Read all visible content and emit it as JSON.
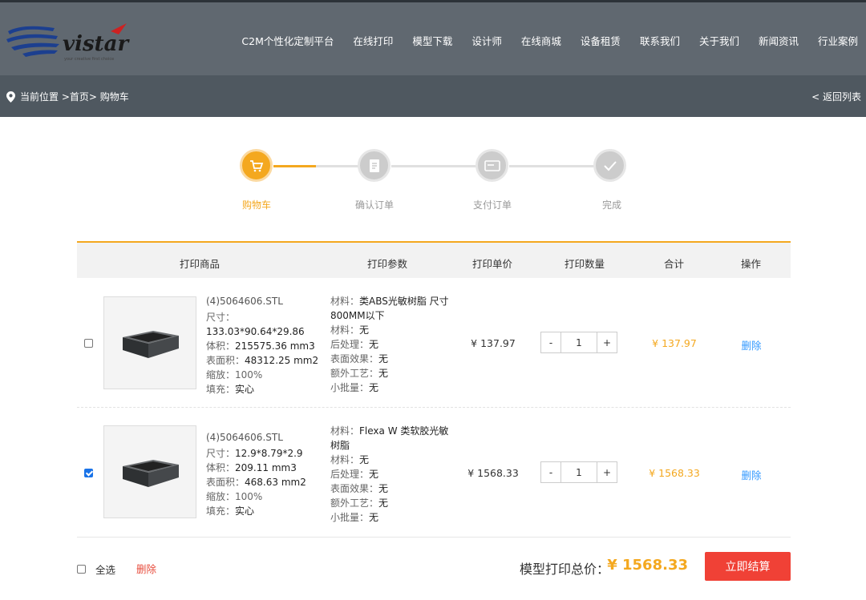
{
  "header": {
    "nav": [
      "C2M个性化定制平台",
      "在线打印",
      "模型下载",
      "设计师",
      "在线商城",
      "设备租赁",
      "联系我们",
      "关于我们",
      "新闻资讯",
      "行业案例"
    ]
  },
  "breadcrumb": {
    "text": "当前位置 >首页> 购物车",
    "back": "< 返回列表"
  },
  "steps": [
    "购物车",
    "确认订单",
    "支付订单",
    "完成"
  ],
  "table": {
    "headers": [
      "打印商品",
      "打印参数",
      "打印单价",
      "打印数量",
      "合计",
      "操作"
    ],
    "rows": [
      {
        "checked": false,
        "filename": "(4)5064606.STL",
        "size_label": "尺寸：",
        "size": "133.03*90.64*29.86",
        "volume_label": "体积：",
        "volume": "215575.36 mm3",
        "area_label": "表面积：",
        "area": "48312.25 mm2",
        "scale_label": "缩放：",
        "scale": "100%",
        "fill_label": "填充：",
        "fill": "实心",
        "material_label": "材料：",
        "material": "类ABS光敏树脂 尺寸800MM以下",
        "texture_label": "材料：",
        "texture": "无",
        "post_label": "后处理：",
        "post": "无",
        "surface_label": "表面效果：",
        "surface": "无",
        "extra_label": "额外工艺：",
        "extra": "无",
        "batch_label": "小批量：",
        "batch": "无",
        "price": "¥ 137.97",
        "qty": "1",
        "total": "¥ 137.97",
        "delete": "删除"
      },
      {
        "checked": true,
        "filename": "(4)5064606.STL",
        "size_label": "尺寸：",
        "size": "12.9*8.79*2.9",
        "volume_label": "体积：",
        "volume": "209.11 mm3",
        "area_label": "表面积：",
        "area": "468.63 mm2",
        "scale_label": "缩放：",
        "scale": "100%",
        "fill_label": "填充：",
        "fill": "实心",
        "material_label": "材料：",
        "material": "Flexa W 类软胶光敏树脂",
        "texture_label": "材料：",
        "texture": "无",
        "post_label": "后处理：",
        "post": "无",
        "surface_label": "表面效果：",
        "surface": "无",
        "extra_label": "额外工艺：",
        "extra": "无",
        "batch_label": "小批量：",
        "batch": "无",
        "price": "¥ 1568.33",
        "qty": "1",
        "total": "¥ 1568.33",
        "delete": "删除"
      }
    ],
    "minus": "-",
    "plus": "+"
  },
  "footer": {
    "select_all": "全选",
    "delete": "删除",
    "sum_label": "模型打印总价：",
    "sum_value": "¥ 1568.33",
    "checkout": "立即结算"
  },
  "colors": {
    "accent": "#f4a81f",
    "checkout": "#f04136",
    "link": "#3399ff",
    "header": "#606870"
  }
}
